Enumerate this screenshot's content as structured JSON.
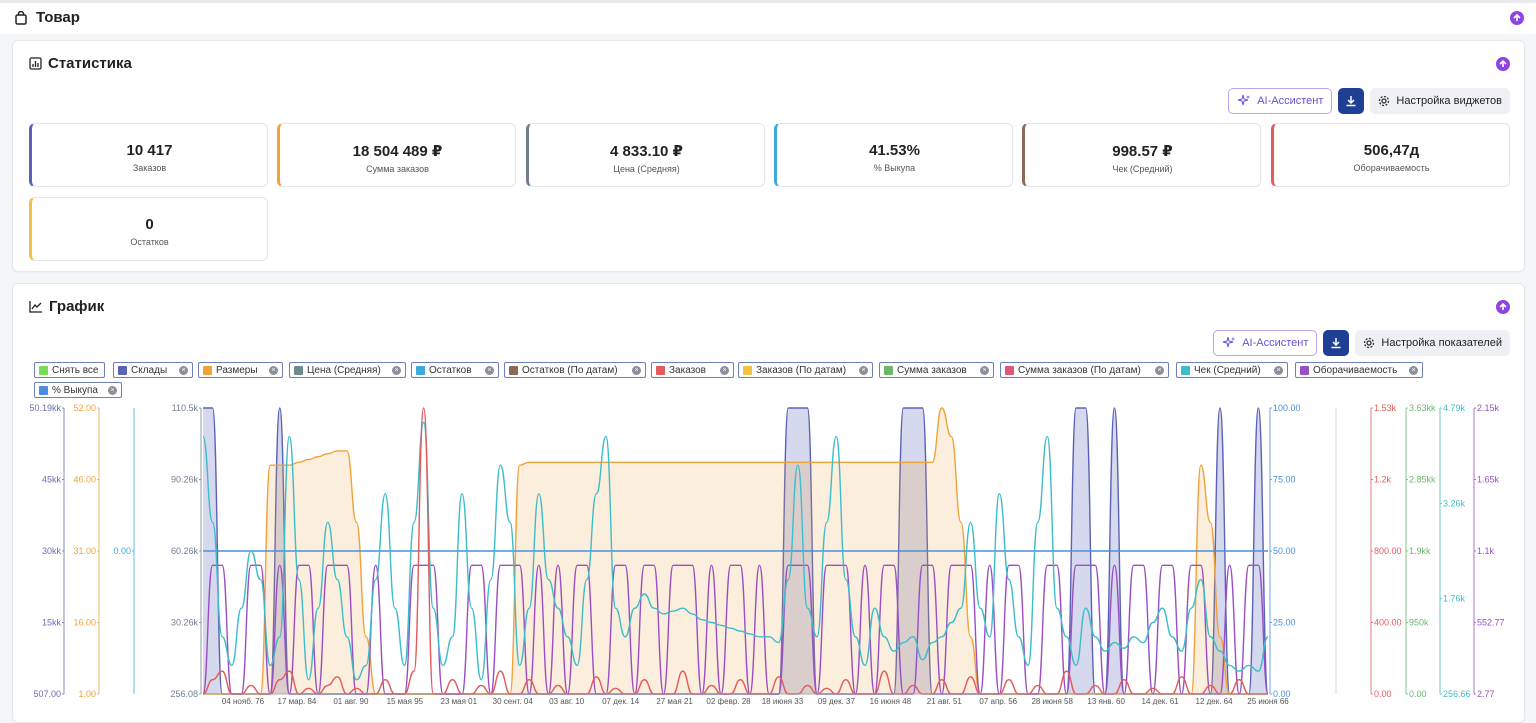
{
  "header": {
    "title": "Товар"
  },
  "stats_section": {
    "title": "Статистика",
    "ai_label": "AI-Ассистент",
    "settings_label": "Настройка виджетов",
    "cards": [
      {
        "value": "10 417",
        "label": "Заказов",
        "color": "#5b63b7"
      },
      {
        "value": "18 504 489 ₽",
        "label": "Сумма заказов",
        "color": "#f0a33b"
      },
      {
        "value": "4 833.10 ₽",
        "label": "Цена (Средняя)",
        "color": "#6f7f8f"
      },
      {
        "value": "41.53%",
        "label": "% Выкупа",
        "color": "#3fa8df"
      },
      {
        "value": "998.57 ₽",
        "label": "Чек (Средний)",
        "color": "#8a6a58"
      },
      {
        "value": "506,47д",
        "label": "Оборачиваемость",
        "color": "#e45b5b"
      },
      {
        "value": "0",
        "label": "Остатков",
        "color": "#f2c244"
      }
    ]
  },
  "chart_section": {
    "title": "График",
    "ai_label": "AI-Ассистент",
    "settings_label": "Настройка показателей",
    "chips": [
      {
        "label": "Снять все",
        "color": "#77dd55"
      },
      {
        "label": "Склады",
        "color": "#5b63b7"
      },
      {
        "label": "Размеры",
        "color": "#f0a33b"
      },
      {
        "label": "Цена (Средняя)",
        "color": "#6f8a8a"
      },
      {
        "label": "Остатков",
        "color": "#3fa8df"
      },
      {
        "label": "Остатков (По датам)",
        "color": "#8a6a58"
      },
      {
        "label": "Заказов",
        "color": "#e45b5b"
      },
      {
        "label": "Заказов (По датам)",
        "color": "#f2c244"
      },
      {
        "label": "Сумма заказов",
        "color": "#6ab86a"
      },
      {
        "label": "Сумма заказов (По датам)",
        "color": "#e0557a"
      },
      {
        "label": "Чек (Средний)",
        "color": "#3dbdc9"
      },
      {
        "label": "Оборачиваемость",
        "color": "#9b4fc4"
      },
      {
        "label": "% Выкупа",
        "color": "#4b8fdc"
      }
    ]
  },
  "chart_data": {
    "type": "area",
    "axes_left": [
      {
        "ticks": [
          "50.19kk",
          "45kk",
          "30kk",
          "15kk",
          "507.00"
        ],
        "color": "#6a6fb5"
      },
      {
        "ticks": [
          "52.00",
          "46.00",
          "31.00",
          "16.00",
          "1.00"
        ],
        "color": "#f0a33b"
      },
      {
        "ticks": [
          "0.00"
        ],
        "color": "#3fa8df"
      },
      {
        "ticks": [
          "110.5k",
          "90.26k",
          "60.26k",
          "30.26k",
          "256.08"
        ],
        "color": "#6f7f8f"
      }
    ],
    "axes_right": [
      {
        "ticks": [
          "100.00",
          "75.00",
          "50.00",
          "25.00",
          "0.00"
        ],
        "color": "#4b8fdc"
      },
      {
        "ticks": [
          "1.53k",
          "1.2k",
          "800.00",
          "400.00",
          "0.00"
        ],
        "color": "#e45b5b"
      },
      {
        "ticks": [
          "3.63kk",
          "2.85kk",
          "1.9kk",
          "950k",
          "0.00"
        ],
        "color": "#6ab86a"
      },
      {
        "ticks": [
          "4.79k",
          "3.26k",
          "1.76k",
          "256.66"
        ],
        "color": "#3dbdc9"
      },
      {
        "ticks": [
          "2.15k",
          "1.65k",
          "1.1k",
          "552.77",
          "2.77"
        ],
        "color": "#9b4fc4"
      }
    ],
    "x_ticks": [
      "04 нояб. 76",
      "17 мар. 84",
      "01 авг. 90",
      "15 мая 95",
      "23 мая 01",
      "30 сент. 04",
      "03 авг. 10",
      "07 дек. 14",
      "27 мая 21",
      "02 февр. 28",
      "18 июня 33",
      "09 дек. 37",
      "16 июня 48",
      "21 авг. 51",
      "07 апр. 56",
      "28 июня 58",
      "13 янв. 60",
      "14 дек. 61",
      "12 дек. 64",
      "25 июня 66"
    ],
    "series": [
      {
        "name": "Склады",
        "color": "#5b63b7",
        "values": [
          100,
          100,
          0,
          0,
          0,
          0,
          0,
          0,
          100,
          0,
          0,
          0,
          0,
          0,
          0,
          0,
          0,
          0,
          0,
          0,
          0,
          0,
          0,
          0,
          0,
          0,
          0,
          0,
          0,
          0,
          0,
          0,
          0,
          0,
          0,
          0,
          0,
          0,
          0,
          0,
          0,
          0,
          0,
          0,
          0,
          0,
          0,
          0,
          0,
          0,
          0,
          0,
          0,
          0,
          0,
          0,
          0,
          0,
          0,
          0,
          0,
          100,
          100,
          100,
          0,
          0,
          0,
          0,
          0,
          0,
          0,
          0,
          0,
          100,
          100,
          100,
          0,
          0,
          0,
          0,
          0,
          0,
          0,
          0,
          0,
          0,
          0,
          0,
          0,
          0,
          0,
          100,
          100,
          0,
          0,
          100,
          0,
          0,
          0,
          0,
          0,
          0,
          0,
          0,
          0,
          0,
          100,
          0,
          0,
          0,
          100,
          0
        ]
      },
      {
        "name": "Размеры",
        "color": "#f0a33b",
        "values": [
          0,
          0,
          0,
          0,
          0,
          0,
          0,
          80,
          80,
          80,
          81,
          82,
          83,
          84,
          85,
          85,
          60,
          20,
          0,
          0,
          0,
          0,
          0,
          0,
          0,
          0,
          0,
          0,
          0,
          0,
          0,
          0,
          0,
          80,
          81,
          81,
          81,
          81,
          81,
          81,
          81,
          81,
          81,
          81,
          81,
          81,
          81,
          81,
          81,
          81,
          81,
          81,
          81,
          81,
          81,
          81,
          81,
          81,
          81,
          81,
          81,
          81,
          81,
          81,
          81,
          81,
          81,
          81,
          81,
          81,
          81,
          81,
          81,
          81,
          81,
          81,
          81,
          100,
          90,
          60,
          20,
          0,
          0,
          0,
          0,
          0,
          0,
          0,
          0,
          0,
          0,
          0,
          0,
          0,
          0,
          0,
          0,
          0,
          0,
          0,
          0,
          0,
          0,
          0,
          80,
          60,
          20,
          0,
          0,
          0,
          0,
          0
        ]
      },
      {
        "name": "% Выкупа",
        "color": "#4b8fdc",
        "values": [
          50,
          50,
          50,
          50,
          50,
          50,
          50,
          50,
          50,
          50,
          50,
          50,
          50,
          50,
          50,
          50,
          50,
          50,
          50,
          50,
          50,
          50,
          50,
          50,
          50,
          50,
          50,
          50,
          50,
          50,
          50,
          50,
          50,
          50,
          50,
          50,
          50,
          50,
          50,
          50,
          50,
          50,
          50,
          50,
          50,
          50,
          50,
          50,
          50,
          50,
          50,
          50,
          50,
          50,
          50,
          50,
          50,
          50,
          50,
          50,
          50,
          50,
          50,
          50,
          50,
          50,
          50,
          50,
          50,
          50,
          50,
          50,
          50,
          50,
          50,
          50,
          50,
          50,
          50,
          50,
          50,
          50,
          50,
          50,
          50,
          50,
          50,
          50,
          50,
          50,
          50,
          50,
          50,
          50,
          50,
          50,
          50,
          50,
          50,
          50,
          50,
          50,
          50,
          50,
          50,
          50,
          50,
          50,
          50,
          50,
          50,
          50
        ]
      },
      {
        "name": "Оборачиваемость",
        "color": "#9b4fc4",
        "values": [
          0,
          45,
          45,
          0,
          0,
          45,
          45,
          0,
          45,
          0,
          45,
          45,
          0,
          45,
          45,
          45,
          0,
          0,
          45,
          0,
          0,
          0,
          45,
          45,
          45,
          0,
          0,
          0,
          45,
          45,
          0,
          45,
          45,
          45,
          0,
          45,
          0,
          45,
          0,
          45,
          45,
          0,
          0,
          45,
          45,
          0,
          45,
          45,
          0,
          45,
          45,
          45,
          0,
          45,
          0,
          45,
          45,
          0,
          45,
          0,
          0,
          45,
          45,
          45,
          0,
          45,
          45,
          45,
          0,
          45,
          0,
          45,
          45,
          0,
          0,
          45,
          45,
          0,
          45,
          45,
          45,
          0,
          45,
          0,
          45,
          45,
          0,
          0,
          45,
          45,
          0,
          45,
          45,
          45,
          0,
          45,
          0,
          45,
          45,
          0,
          45,
          45,
          0,
          45,
          45,
          0,
          0,
          45,
          0,
          45,
          45,
          0
        ]
      },
      {
        "name": "Чек (Средний)",
        "color": "#3dbdc9",
        "values": [
          90,
          60,
          20,
          10,
          30,
          50,
          40,
          10,
          20,
          90,
          40,
          5,
          30,
          60,
          40,
          20,
          5,
          10,
          40,
          70,
          30,
          10,
          60,
          95,
          30,
          10,
          20,
          70,
          30,
          5,
          40,
          80,
          60,
          10,
          30,
          70,
          40,
          30,
          20,
          10,
          40,
          70,
          90,
          30,
          20,
          30,
          35,
          30,
          28,
          29,
          30,
          28,
          26,
          25,
          24,
          23,
          22,
          21,
          20,
          20,
          18,
          40,
          80,
          30,
          20,
          60,
          90,
          40,
          20,
          10,
          30,
          20,
          15,
          18,
          20,
          12,
          18,
          20,
          25,
          30,
          60,
          30,
          20,
          70,
          40,
          20,
          10,
          60,
          90,
          30,
          20,
          10,
          30,
          20,
          15,
          18,
          16,
          20,
          18,
          25,
          30,
          20,
          15,
          30,
          40,
          20,
          15,
          10,
          8,
          10,
          8,
          20
        ]
      },
      {
        "name": "Заказов",
        "color": "#e45b5b",
        "values": [
          0,
          5,
          8,
          0,
          0,
          3,
          0,
          0,
          5,
          8,
          0,
          2,
          0,
          3,
          6,
          0,
          2,
          0,
          0,
          5,
          0,
          0,
          8,
          100,
          0,
          0,
          5,
          0,
          0,
          3,
          0,
          8,
          0,
          0,
          5,
          0,
          0,
          3,
          0,
          0,
          0,
          6,
          0,
          2,
          0,
          0,
          5,
          0,
          0,
          0,
          8,
          0,
          0,
          3,
          0,
          0,
          5,
          0,
          0,
          0,
          6,
          0,
          0,
          3,
          0,
          2,
          0,
          5,
          0,
          0,
          0,
          8,
          0,
          0,
          3,
          0,
          0,
          5,
          0,
          0,
          6,
          0,
          0,
          0,
          5,
          0,
          0,
          3,
          0,
          0,
          8,
          0,
          0,
          3,
          0,
          0,
          5,
          0,
          0,
          2,
          0,
          0,
          6,
          0,
          0,
          3,
          0,
          0,
          5,
          0,
          0,
          0
        ]
      }
    ]
  }
}
